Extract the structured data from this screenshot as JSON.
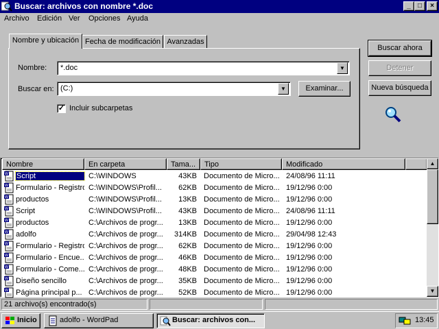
{
  "window": {
    "title": "Buscar: archivos con nombre *.doc",
    "controls": {
      "minimize": "_",
      "maximize": "□",
      "close": "×"
    }
  },
  "menu": [
    "Archivo",
    "Edición",
    "Ver",
    "Opciones",
    "Ayuda"
  ],
  "tabs": [
    "Nombre y ubicación",
    "Fecha de modificación",
    "Avanzadas"
  ],
  "form": {
    "name_label": "Nombre:",
    "name_value": "*.doc",
    "lookin_label": "Buscar en:",
    "lookin_value": "(C:)",
    "browse_button": "Examinar...",
    "subfolders_label": "Incluir subcarpetas",
    "subfolders_checked": true
  },
  "buttons": {
    "search_now": "Buscar ahora",
    "stop": "Detener",
    "new_search": "Nueva búsqueda"
  },
  "icons": {
    "search_magnifier": "magnifier-icon",
    "doc": "wordpad-document-icon"
  },
  "list": {
    "columns": [
      "Nombre",
      "En carpeta",
      "Tama...",
      "Tipo",
      "Modificado"
    ],
    "rows": [
      {
        "name": "Script",
        "folder": "C:\\WINDOWS",
        "size": "43KB",
        "type": "Documento de Micro...",
        "modified": "24/08/96 11:11"
      },
      {
        "name": "Formulario - Registro",
        "folder": "C:\\WINDOWS\\Profil...",
        "size": "62KB",
        "type": "Documento de Micro...",
        "modified": "19/12/96 0:00"
      },
      {
        "name": "productos",
        "folder": "C:\\WINDOWS\\Profil...",
        "size": "13KB",
        "type": "Documento de Micro...",
        "modified": "19/12/96 0:00"
      },
      {
        "name": "Script",
        "folder": "C:\\WINDOWS\\Profil...",
        "size": "43KB",
        "type": "Documento de Micro...",
        "modified": "24/08/96 11:11"
      },
      {
        "name": "productos",
        "folder": "C:\\Archivos de progr...",
        "size": "13KB",
        "type": "Documento de Micro...",
        "modified": "19/12/96 0:00"
      },
      {
        "name": "adolfo",
        "folder": "C:\\Archivos de progr...",
        "size": "314KB",
        "type": "Documento de Micro...",
        "modified": "29/04/98 12:43"
      },
      {
        "name": "Formulario - Registro",
        "folder": "C:\\Archivos de progr...",
        "size": "62KB",
        "type": "Documento de Micro...",
        "modified": "19/12/96 0:00"
      },
      {
        "name": "Formulario - Encue...",
        "folder": "C:\\Archivos de progr...",
        "size": "46KB",
        "type": "Documento de Micro...",
        "modified": "19/12/96 0:00"
      },
      {
        "name": "Formulario - Come...",
        "folder": "C:\\Archivos de progr...",
        "size": "48KB",
        "type": "Documento de Micro...",
        "modified": "19/12/96 0:00"
      },
      {
        "name": "Diseño sencillo",
        "folder": "C:\\Archivos de progr...",
        "size": "35KB",
        "type": "Documento de Micro...",
        "modified": "19/12/96 0:00"
      },
      {
        "name": "Página principal p...",
        "folder": "C:\\Archivos de progr...",
        "size": "52KB",
        "type": "Documento de Micro...",
        "modified": "19/12/96 0:00"
      }
    ]
  },
  "status": {
    "found": "21 archivo(s) encontrado(s)"
  },
  "taskbar": {
    "start": "Inicio",
    "tasks": [
      "adolfo - WordPad",
      "Buscar: archivos con..."
    ],
    "clock": "13:45"
  },
  "colors": {
    "titlebar": "#000080",
    "face": "#c0c0c0",
    "desktop": "#008080",
    "selection": "#000080"
  }
}
